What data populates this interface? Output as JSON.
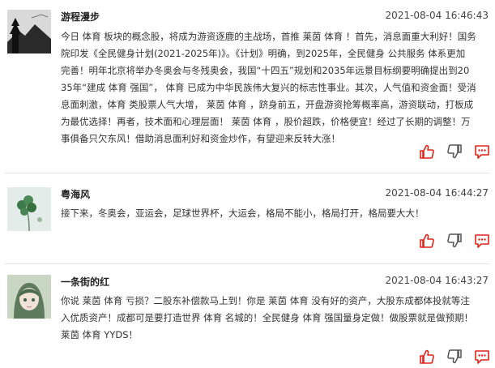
{
  "posts": [
    {
      "name": "游程漫步",
      "time": "2021-08-04 16:46:43",
      "avatar_icon": "mountain-pine-silhouette-avatar",
      "content_lines": [
        "今日 体育 板块的概念股，将成为游资逐鹿的主战场，首推 莱茵 体育 ！首先，消息面重大利好！国务",
        "院印发《全民健身计划(2021-2025年)》。《计划》明确，到2025年，全民健身 公共服务 体系更加",
        "完善！明年北京将举办冬奥会与冬残奥会，我国“十四五”规划和2035年远景目标纲要明确提出到20",
        "35年“建成 体育 强国”， 体育 已成为中华民族伟大复兴的标志性事业。其次，人气值和资金面！受消",
        "息面刺激，体育 类股票人气大增， 莱茵 体育 ，跻身前五，开盘游资抢筹概率高，游资联动，打板成",
        "为最优选择！再者，技术面和心理层面！ 莱茵 体育 ，股价超跌，价格便宜！经过了长期的调整！万",
        "事俱备只欠东风！借助消息面利好和资金炒作，有望迎来反转大涨！"
      ]
    },
    {
      "name": "粤海风",
      "time": "2021-08-04 16:44:27",
      "avatar_icon": "clover-plant-avatar",
      "content_lines": [
        "接下来，冬奥会，亚运会，足球世界杯，大运会，格局不能小，格局打开，格局要大大！"
      ]
    },
    {
      "name": "一条街的红",
      "time": "2021-08-04 16:43:27",
      "avatar_icon": "anime-girl-avatar",
      "content_lines": [
        "你说 莱茵 体育 亏损？二股东补偿款马上到！你是 莱茵 体育 没有好的资产，大股东成都体投就等注",
        "入优质资产！成都可是要打造世界 体育 名城的！全民健身 体育 强国量身定做！做股票就是做预期！",
        "莱茵 体育 YYDS！"
      ]
    }
  ],
  "actions": {
    "like_icon": "thumbs-up-icon",
    "dislike_icon": "thumbs-down-icon",
    "reply_icon": "comment-bubble-icon",
    "accent_color": "#e2231a"
  }
}
